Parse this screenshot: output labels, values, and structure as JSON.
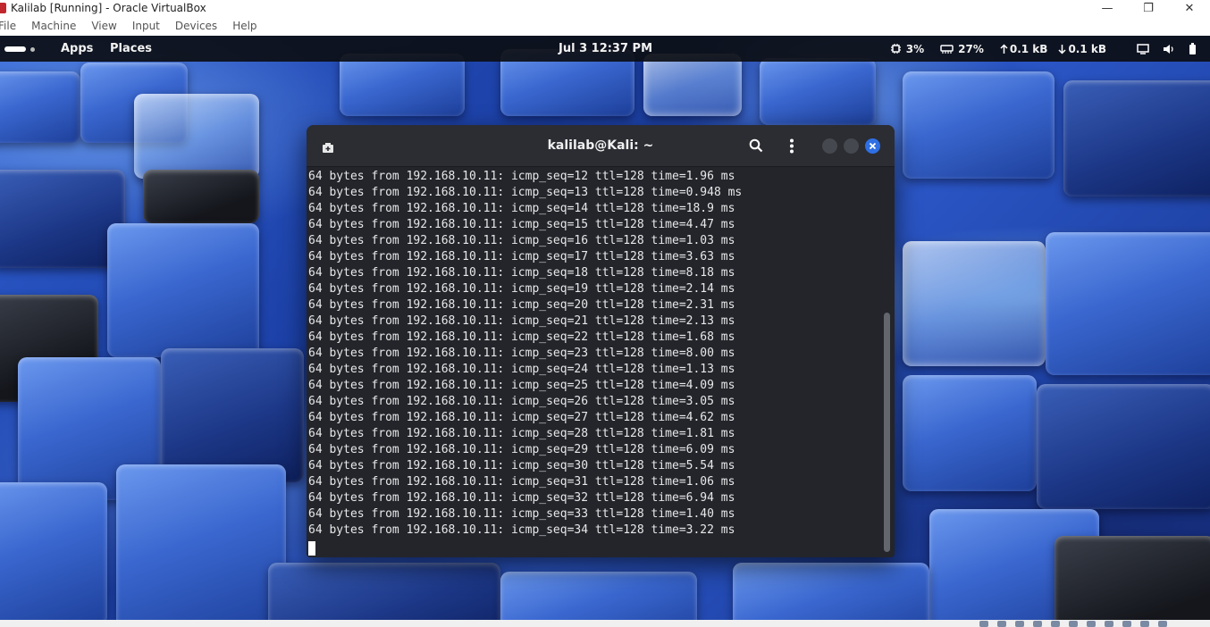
{
  "host": {
    "window_title": "Kalilab [Running] - Oracle VirtualBox",
    "menu": [
      "File",
      "Machine",
      "View",
      "Input",
      "Devices",
      "Help"
    ]
  },
  "panel": {
    "apps_label": "Apps",
    "places_label": "Places",
    "clock": "Jul 3  12:37 PM",
    "cpu": "3%",
    "memory": "27%",
    "upload": "0.1 kB",
    "download": "0.1 kB"
  },
  "terminal": {
    "title": "kalilab@Kali: ~",
    "lines": [
      "64 bytes from 192.168.10.11: icmp_seq=12 ttl=128 time=1.96 ms",
      "64 bytes from 192.168.10.11: icmp_seq=13 ttl=128 time=0.948 ms",
      "64 bytes from 192.168.10.11: icmp_seq=14 ttl=128 time=18.9 ms",
      "64 bytes from 192.168.10.11: icmp_seq=15 ttl=128 time=4.47 ms",
      "64 bytes from 192.168.10.11: icmp_seq=16 ttl=128 time=1.03 ms",
      "64 bytes from 192.168.10.11: icmp_seq=17 ttl=128 time=3.63 ms",
      "64 bytes from 192.168.10.11: icmp_seq=18 ttl=128 time=8.18 ms",
      "64 bytes from 192.168.10.11: icmp_seq=19 ttl=128 time=2.14 ms",
      "64 bytes from 192.168.10.11: icmp_seq=20 ttl=128 time=2.31 ms",
      "64 bytes from 192.168.10.11: icmp_seq=21 ttl=128 time=2.13 ms",
      "64 bytes from 192.168.10.11: icmp_seq=22 ttl=128 time=1.68 ms",
      "64 bytes from 192.168.10.11: icmp_seq=23 ttl=128 time=8.00 ms",
      "64 bytes from 192.168.10.11: icmp_seq=24 ttl=128 time=1.13 ms",
      "64 bytes from 192.168.10.11: icmp_seq=25 ttl=128 time=4.09 ms",
      "64 bytes from 192.168.10.11: icmp_seq=26 ttl=128 time=3.05 ms",
      "64 bytes from 192.168.10.11: icmp_seq=27 ttl=128 time=4.62 ms",
      "64 bytes from 192.168.10.11: icmp_seq=28 ttl=128 time=1.81 ms",
      "64 bytes from 192.168.10.11: icmp_seq=29 ttl=128 time=6.09 ms",
      "64 bytes from 192.168.10.11: icmp_seq=30 ttl=128 time=5.54 ms",
      "64 bytes from 192.168.10.11: icmp_seq=31 ttl=128 time=1.06 ms",
      "64 bytes from 192.168.10.11: icmp_seq=32 ttl=128 time=6.94 ms",
      "64 bytes from 192.168.10.11: icmp_seq=33 ttl=128 time=1.40 ms",
      "64 bytes from 192.168.10.11: icmp_seq=34 ttl=128 time=3.22 ms"
    ]
  },
  "icons": {
    "vb_logo": "virtualbox-logo-icon",
    "new_tab": "new-tab-icon",
    "search": "search-icon",
    "menu": "kebab-menu-icon",
    "close": "close-icon",
    "cpu": "cpu-icon",
    "memory": "memory-icon",
    "upload": "arrow-up-icon",
    "download": "arrow-down-icon",
    "display": "display-icon",
    "volume": "volume-icon",
    "battery": "battery-icon"
  },
  "colors": {
    "panel_bg": "#0c0e14",
    "terminal_bg": "#23252b",
    "close_accent": "#2f6fe4",
    "vbox_red": "#c1272d"
  }
}
